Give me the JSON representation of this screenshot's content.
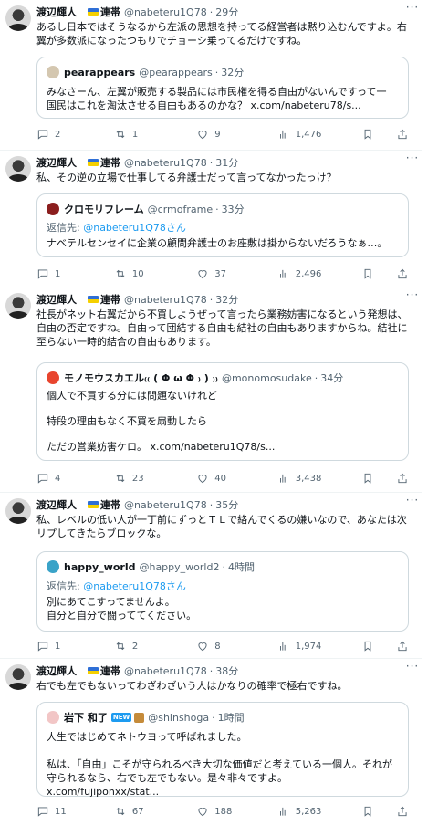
{
  "author": {
    "name": "渡辺輝人",
    "label": "連帯",
    "handle": "@nabeteru1Q78"
  },
  "tweets": [
    {
      "time": "29分",
      "text": "あるし日本ではそうなるから左派の思想を持ってる経営者は黙り込むんですよ。右\n翼が多数派になったつもりでチョーシ乗ってるだけですね。",
      "quote": {
        "name": "pearappears",
        "handle": "@pearappears",
        "time": "32分",
        "text": "みなさーん、左翼が販売する製品には市民権を得る自由がないんですって一\n国民はこれを淘汰させる自由もあるのかな？ x.com/nabeteru78/s..."
      },
      "stats": {
        "replies": "2",
        "reposts": "1",
        "likes": "9",
        "views": "1,476"
      }
    },
    {
      "time": "31分",
      "text": "私、その逆の立場で仕事してる弁護士だって言ってなかったっけ？",
      "quote": {
        "name": "クロモリフレーム",
        "handle": "@crmoframe",
        "time": "33分",
        "reply_label": "返信先:",
        "reply_handle": "@nabeteru1Q78さん",
        "text": "ナベテルセンセイに企業の顧問弁護士のお座敷は掛からないだろうなぁ…。"
      },
      "stats": {
        "replies": "1",
        "reposts": "10",
        "likes": "37",
        "views": "2,496"
      }
    },
    {
      "time": "32分",
      "text": "社長がネット右翼だから不買しようぜって言ったら業務妨害になるという発想は、\n自由の否定ですね。自由って団結する自由も結社の自由もありますからね。結社に\n至らない一時的結合の自由もあります。",
      "quote": {
        "name": "モノモウスカエル₍₍ ( Φ ω Φ ₎ ) ₎₎",
        "handle": "@monomosudake",
        "time": "34分",
        "text": "個人で不買する分には問題ないけれど\n\n特段の理由もなく不買を扇動したら\n\nただの営業妨害ケロ。 x.com/nabeteru1Q78/s..."
      },
      "stats": {
        "replies": "4",
        "reposts": "23",
        "likes": "40",
        "views": "3,438"
      }
    },
    {
      "time": "35分",
      "text": "私、レベルの低い人が一丁前にずっとＴＬで絡んでくるの嫌いなので、あなたは次\nリプしてきたらブロックな。",
      "quote": {
        "name": "happy_world",
        "handle": "@happy_world2",
        "time": "4時間",
        "reply_label": "返信先:",
        "reply_handle": "@nabeteru1Q78さん",
        "text": "別にあてこすってませんよ。\n自分と自分で闘っててください。"
      },
      "stats": {
        "replies": "1",
        "reposts": "2",
        "likes": "8",
        "views": "1,974"
      }
    },
    {
      "time": "38分",
      "text": "右でも左でもないってわざわざいう人はかなりの確率で極右ですね。",
      "quote": {
        "name": "岩下 和了",
        "badge": "NEW",
        "handle": "@shinshoga",
        "time": "1時間",
        "text": "人生ではじめてネトウヨって呼ばれました。\n\n私は、「自由」こそが守られるべき大切な価値だと考えている一個人。それが\n守られるなら、右でも左でもない。是々非々ですよ。 x.com/fujiponxx/stat..."
      },
      "stats": {
        "replies": "11",
        "reposts": "67",
        "likes": "188",
        "views": "5,263"
      }
    }
  ],
  "icons": [
    "more-icon",
    "reply-icon",
    "repost-icon",
    "like-icon",
    "views-icon",
    "bookmark-icon",
    "share-icon"
  ],
  "colors": {
    "accent": "#1d9bf0",
    "muted": "#536471",
    "border": "#cfd9de"
  }
}
